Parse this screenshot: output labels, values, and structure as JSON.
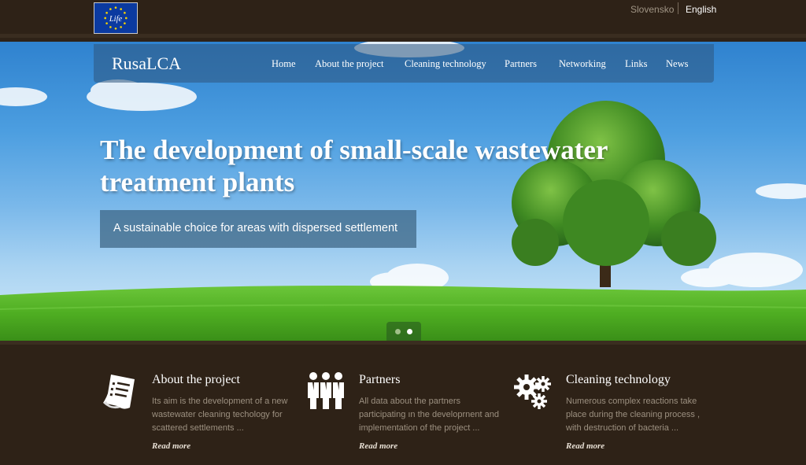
{
  "top_bar": {
    "languages": [
      {
        "label": "Slovensko",
        "active": false
      },
      {
        "label": "English",
        "active": true
      }
    ],
    "eu_logo_text": "Life"
  },
  "nav": {
    "brand": "RusaLCA",
    "items": [
      "Home",
      "About the project",
      "Cleaning technology",
      "Partners",
      "Networking",
      "Links",
      "News"
    ]
  },
  "hero": {
    "headline": "The development of small-scale wastewater treatment plants",
    "tagline": "A sustainable choice for areas with dispersed settlement",
    "slide_count": 2,
    "active_slide": 2
  },
  "features": [
    {
      "icon": "document-list-icon",
      "title": "About the project",
      "text": "Its aim is the development of a new wastewater cleaning techology for scattered settlements ...",
      "link": "Read more"
    },
    {
      "icon": "people-group-icon",
      "title": "Partners",
      "text": "All data about the partners participating ın the developrnent and implementation of the project ...",
      "link": "Read more"
    },
    {
      "icon": "gears-icon",
      "title": "Cleaning technology",
      "text": "Numerous complex reactions take place during the cleaning process , with destruction of bacteria ...",
      "link": "Read more"
    }
  ],
  "colors": {
    "background": "#2e2217",
    "accent_text": "#9c9080",
    "sky": "#4c9ee0",
    "grass": "#5cb82a"
  }
}
